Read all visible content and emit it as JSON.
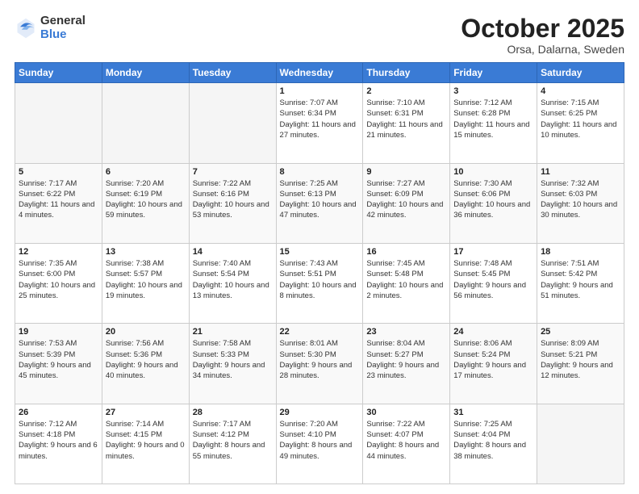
{
  "logo": {
    "general": "General",
    "blue": "Blue"
  },
  "title": {
    "month": "October 2025",
    "location": "Orsa, Dalarna, Sweden"
  },
  "days_of_week": [
    "Sunday",
    "Monday",
    "Tuesday",
    "Wednesday",
    "Thursday",
    "Friday",
    "Saturday"
  ],
  "weeks": [
    [
      {
        "day": "",
        "info": ""
      },
      {
        "day": "",
        "info": ""
      },
      {
        "day": "",
        "info": ""
      },
      {
        "day": "1",
        "info": "Sunrise: 7:07 AM\nSunset: 6:34 PM\nDaylight: 11 hours\nand 27 minutes."
      },
      {
        "day": "2",
        "info": "Sunrise: 7:10 AM\nSunset: 6:31 PM\nDaylight: 11 hours\nand 21 minutes."
      },
      {
        "day": "3",
        "info": "Sunrise: 7:12 AM\nSunset: 6:28 PM\nDaylight: 11 hours\nand 15 minutes."
      },
      {
        "day": "4",
        "info": "Sunrise: 7:15 AM\nSunset: 6:25 PM\nDaylight: 11 hours\nand 10 minutes."
      }
    ],
    [
      {
        "day": "5",
        "info": "Sunrise: 7:17 AM\nSunset: 6:22 PM\nDaylight: 11 hours\nand 4 minutes."
      },
      {
        "day": "6",
        "info": "Sunrise: 7:20 AM\nSunset: 6:19 PM\nDaylight: 10 hours\nand 59 minutes."
      },
      {
        "day": "7",
        "info": "Sunrise: 7:22 AM\nSunset: 6:16 PM\nDaylight: 10 hours\nand 53 minutes."
      },
      {
        "day": "8",
        "info": "Sunrise: 7:25 AM\nSunset: 6:13 PM\nDaylight: 10 hours\nand 47 minutes."
      },
      {
        "day": "9",
        "info": "Sunrise: 7:27 AM\nSunset: 6:09 PM\nDaylight: 10 hours\nand 42 minutes."
      },
      {
        "day": "10",
        "info": "Sunrise: 7:30 AM\nSunset: 6:06 PM\nDaylight: 10 hours\nand 36 minutes."
      },
      {
        "day": "11",
        "info": "Sunrise: 7:32 AM\nSunset: 6:03 PM\nDaylight: 10 hours\nand 30 minutes."
      }
    ],
    [
      {
        "day": "12",
        "info": "Sunrise: 7:35 AM\nSunset: 6:00 PM\nDaylight: 10 hours\nand 25 minutes."
      },
      {
        "day": "13",
        "info": "Sunrise: 7:38 AM\nSunset: 5:57 PM\nDaylight: 10 hours\nand 19 minutes."
      },
      {
        "day": "14",
        "info": "Sunrise: 7:40 AM\nSunset: 5:54 PM\nDaylight: 10 hours\nand 13 minutes."
      },
      {
        "day": "15",
        "info": "Sunrise: 7:43 AM\nSunset: 5:51 PM\nDaylight: 10 hours\nand 8 minutes."
      },
      {
        "day": "16",
        "info": "Sunrise: 7:45 AM\nSunset: 5:48 PM\nDaylight: 10 hours\nand 2 minutes."
      },
      {
        "day": "17",
        "info": "Sunrise: 7:48 AM\nSunset: 5:45 PM\nDaylight: 9 hours\nand 56 minutes."
      },
      {
        "day": "18",
        "info": "Sunrise: 7:51 AM\nSunset: 5:42 PM\nDaylight: 9 hours\nand 51 minutes."
      }
    ],
    [
      {
        "day": "19",
        "info": "Sunrise: 7:53 AM\nSunset: 5:39 PM\nDaylight: 9 hours\nand 45 minutes."
      },
      {
        "day": "20",
        "info": "Sunrise: 7:56 AM\nSunset: 5:36 PM\nDaylight: 9 hours\nand 40 minutes."
      },
      {
        "day": "21",
        "info": "Sunrise: 7:58 AM\nSunset: 5:33 PM\nDaylight: 9 hours\nand 34 minutes."
      },
      {
        "day": "22",
        "info": "Sunrise: 8:01 AM\nSunset: 5:30 PM\nDaylight: 9 hours\nand 28 minutes."
      },
      {
        "day": "23",
        "info": "Sunrise: 8:04 AM\nSunset: 5:27 PM\nDaylight: 9 hours\nand 23 minutes."
      },
      {
        "day": "24",
        "info": "Sunrise: 8:06 AM\nSunset: 5:24 PM\nDaylight: 9 hours\nand 17 minutes."
      },
      {
        "day": "25",
        "info": "Sunrise: 8:09 AM\nSunset: 5:21 PM\nDaylight: 9 hours\nand 12 minutes."
      }
    ],
    [
      {
        "day": "26",
        "info": "Sunrise: 7:12 AM\nSunset: 4:18 PM\nDaylight: 9 hours\nand 6 minutes."
      },
      {
        "day": "27",
        "info": "Sunrise: 7:14 AM\nSunset: 4:15 PM\nDaylight: 9 hours\nand 0 minutes."
      },
      {
        "day": "28",
        "info": "Sunrise: 7:17 AM\nSunset: 4:12 PM\nDaylight: 8 hours\nand 55 minutes."
      },
      {
        "day": "29",
        "info": "Sunrise: 7:20 AM\nSunset: 4:10 PM\nDaylight: 8 hours\nand 49 minutes."
      },
      {
        "day": "30",
        "info": "Sunrise: 7:22 AM\nSunset: 4:07 PM\nDaylight: 8 hours\nand 44 minutes."
      },
      {
        "day": "31",
        "info": "Sunrise: 7:25 AM\nSunset: 4:04 PM\nDaylight: 8 hours\nand 38 minutes."
      },
      {
        "day": "",
        "info": ""
      }
    ]
  ]
}
